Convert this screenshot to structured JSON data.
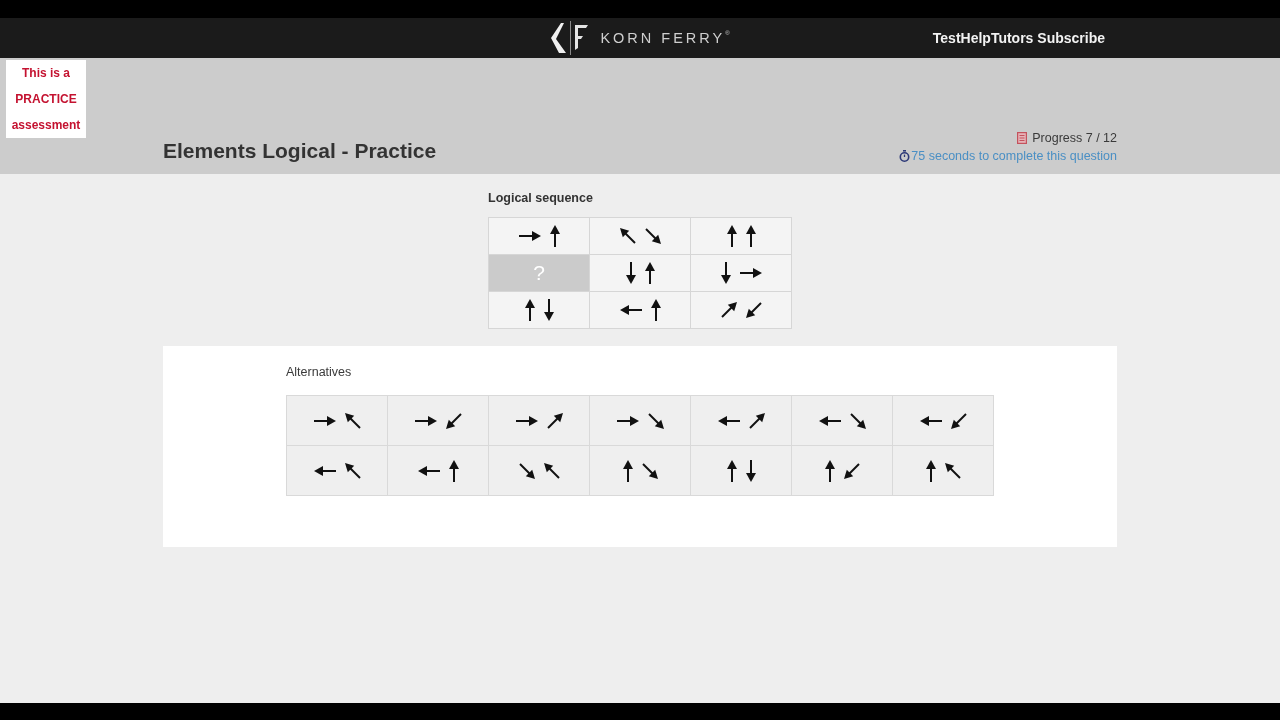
{
  "header": {
    "brand": "KORN FERRY$^{®}$",
    "channel_text": "TestHelpTutors Subscribe"
  },
  "notice": "This is a PRACTICE assessment",
  "page": {
    "title": "Elements Logical - Practice",
    "progress": "Progress 7 / 12",
    "timer": "75 seconds to complete this question"
  },
  "sequence": {
    "heading": "Logical sequence",
    "rows": [
      [
        {
          "kind": "arrows",
          "arrows": [
            {
              "kind": "right"
            },
            {
              "kind": "up"
            }
          ]
        },
        {
          "kind": "arrows",
          "arrows": [
            {
              "kind": "up-left"
            },
            {
              "kind": "down-right"
            }
          ]
        },
        {
          "kind": "arrows",
          "arrows": [
            {
              "kind": "up"
            },
            {
              "kind": "up"
            }
          ]
        }
      ],
      [
        {
          "kind": "missing",
          "placeholder": "?"
        },
        {
          "kind": "arrows",
          "arrows": [
            {
              "kind": "down"
            },
            {
              "kind": "up"
            }
          ]
        },
        {
          "kind": "arrows",
          "arrows": [
            {
              "kind": "down"
            },
            {
              "kind": "right"
            }
          ]
        }
      ],
      [
        {
          "kind": "arrows",
          "arrows": [
            {
              "kind": "up"
            },
            {
              "kind": "down"
            }
          ]
        },
        {
          "kind": "arrows",
          "arrows": [
            {
              "kind": "left"
            },
            {
              "kind": "up"
            }
          ]
        },
        {
          "kind": "arrows",
          "arrows": [
            {
              "kind": "up-right"
            },
            {
              "kind": "down-left"
            }
          ]
        }
      ]
    ]
  },
  "alternatives": {
    "heading": "Alternatives",
    "rows": [
      [
        {
          "selected": false,
          "arrows": [
            {
              "kind": "right"
            },
            {
              "kind": "up-left"
            }
          ]
        },
        {
          "selected": false,
          "arrows": [
            {
              "kind": "right"
            },
            {
              "kind": "down-left"
            }
          ]
        },
        {
          "selected": false,
          "arrows": [
            {
              "kind": "right"
            },
            {
              "kind": "up-right"
            }
          ]
        },
        {
          "selected": false,
          "arrows": [
            {
              "kind": "right"
            },
            {
              "kind": "down-right"
            }
          ]
        },
        {
          "selected": false,
          "arrows": [
            {
              "kind": "left"
            },
            {
              "kind": "up-right"
            }
          ]
        },
        {
          "selected": false,
          "arrows": [
            {
              "kind": "left"
            },
            {
              "kind": "down-right"
            }
          ]
        },
        {
          "selected": false,
          "arrows": [
            {
              "kind": "left"
            },
            {
              "kind": "down-left"
            }
          ]
        }
      ],
      [
        {
          "selected": false,
          "arrows": [
            {
              "kind": "left"
            },
            {
              "kind": "up-left"
            }
          ]
        },
        {
          "selected": false,
          "arrows": [
            {
              "kind": "left"
            },
            {
              "kind": "up"
            }
          ]
        },
        {
          "selected": false,
          "arrows": [
            {
              "kind": "down-right"
            },
            {
              "kind": "up-left"
            }
          ]
        },
        {
          "selected": false,
          "arrows": [
            {
              "kind": "up"
            },
            {
              "kind": "down-right"
            }
          ]
        },
        {
          "selected": false,
          "arrows": [
            {
              "kind": "up"
            },
            {
              "kind": "down"
            }
          ]
        },
        {
          "selected": false,
          "arrows": [
            {
              "kind": "up"
            },
            {
              "kind": "down-left"
            }
          ]
        },
        {
          "selected": false,
          "arrows": [
            {
              "kind": "up"
            },
            {
              "kind": "up-left"
            }
          ]
        }
      ]
    ]
  }
}
